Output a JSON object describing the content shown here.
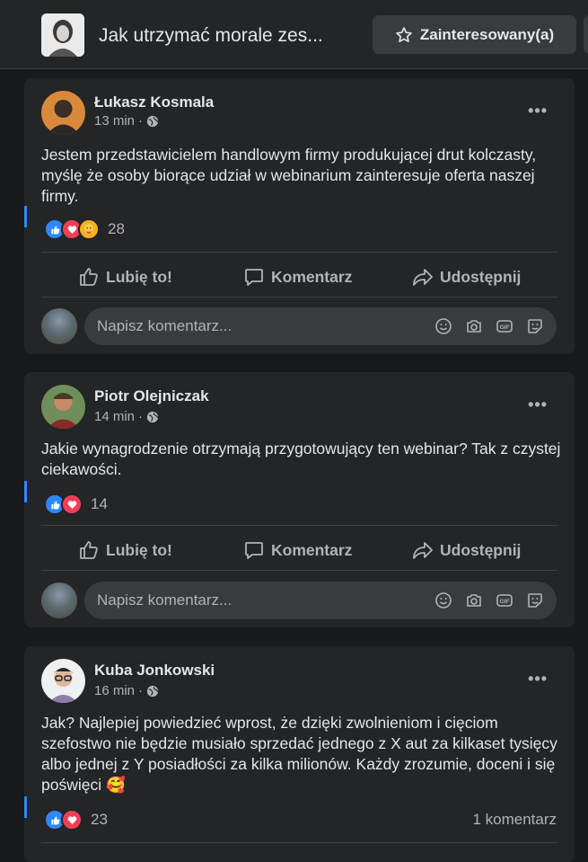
{
  "header": {
    "event_title": "Jak utrzymać morale zes...",
    "interested_label": "Zainteresowany(a)"
  },
  "actions": {
    "like": "Lubię to!",
    "comment": "Komentarz",
    "share": "Udostępnij"
  },
  "comment_box": {
    "placeholder": "Napisz komentarz..."
  },
  "posts": [
    {
      "author": "Łukasz Kosmala",
      "time": "13 min",
      "separator": "·",
      "text": "Jestem przedstawicielem handlowym firmy produkującej drut kolczasty, myślę że osoby biorące udział w webinarium zainteresuje oferta naszej firmy.",
      "reactions": [
        "like",
        "love",
        "care"
      ],
      "reaction_count": "28"
    },
    {
      "author": "Piotr Olejniczak",
      "time": "14 min",
      "separator": "·",
      "text": "Jakie wynagrodzenie otrzymają przygotowujący ten webinar? Tak z czystej ciekawości.",
      "reactions": [
        "like",
        "love"
      ],
      "reaction_count": "14"
    },
    {
      "author": "Kuba Jonkowski",
      "time": "16 min",
      "separator": "·",
      "text": "Jak? Najlepiej powiedzieć wprost, że dzięki zwolnieniom i cięciom szefostwo nie będzie musiało sprzedać jednego z X aut za kilkaset tysięcy albo jednej z Y posiadłości za kilka milionów. Każdy zrozumie, doceni i się poświęci 🥰",
      "reactions": [
        "like",
        "love"
      ],
      "reaction_count": "23",
      "comment_count": "1 komentarz"
    }
  ],
  "colors": {
    "background": "#18191a",
    "card": "#242526",
    "like_blue": "#2d88ff",
    "love_red": "#f33e58",
    "care_yellow": "#f7b125"
  }
}
